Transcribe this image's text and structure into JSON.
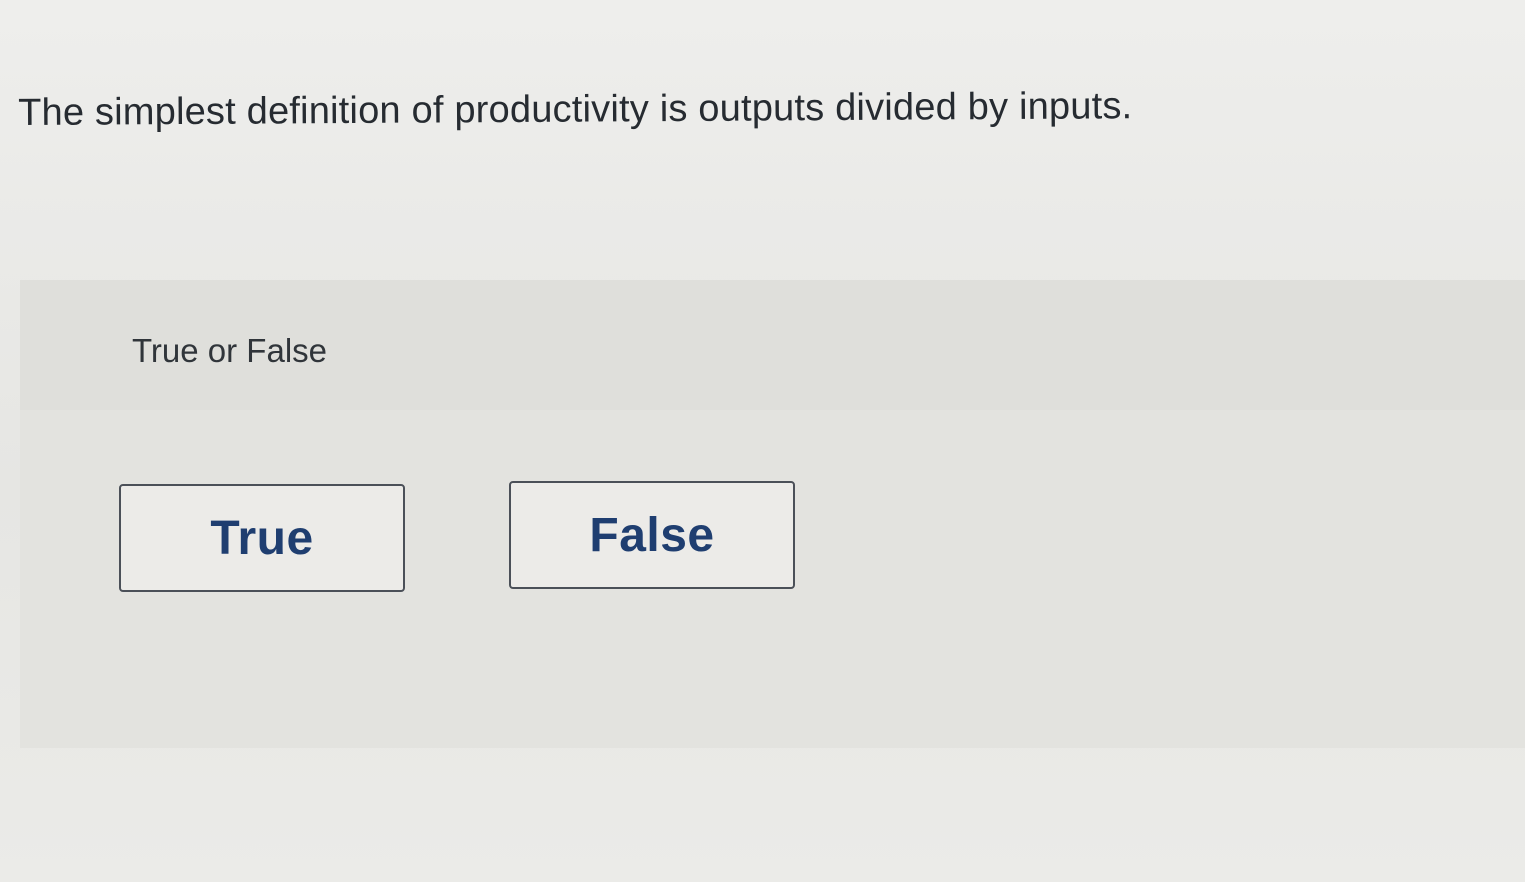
{
  "question": {
    "text": "The simplest definition of productivity is outputs divided by inputs."
  },
  "answer_area": {
    "prompt": "True or False",
    "options": [
      {
        "label": "True"
      },
      {
        "label": "False"
      }
    ]
  },
  "colors": {
    "button_text": "#1f3e70",
    "button_border": "#4b5058",
    "question_text": "#262b31"
  }
}
